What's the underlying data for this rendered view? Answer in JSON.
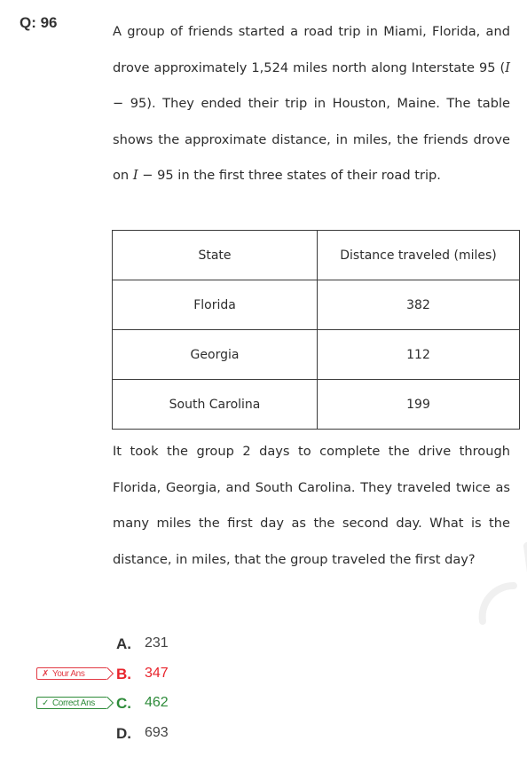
{
  "question": {
    "number_label": "Q: 96",
    "stem_before_table": [
      {
        "text": "A group of friends started a road trip in Miami, Florida, and drove approximately 1,524 miles north along Interstate 95 ("
      },
      {
        "math": "I"
      },
      {
        "text": " − 95). They ended their trip in Houston, Maine. The table shows the approximate distance, in miles, the friends drove on "
      },
      {
        "math": "I"
      },
      {
        "text": " − 95 in the first three states of their road trip."
      }
    ],
    "table": {
      "headers": [
        "State",
        "Distance traveled (miles)"
      ],
      "rows": [
        [
          "Florida",
          "382"
        ],
        [
          "Georgia",
          "112"
        ],
        [
          "South Carolina",
          "199"
        ]
      ]
    },
    "stem_after_table": "It took the group 2 days to complete the drive through Florida, Georgia, and South Carolina. They traveled twice as many miles the first day as the second day. What is the distance, in miles, that the group traveled the first day?",
    "choices": [
      {
        "letter": "A.",
        "value": "231",
        "status": "none",
        "badge": null
      },
      {
        "letter": "B.",
        "value": "347",
        "status": "wrong",
        "badge": {
          "mark": "✗",
          "label": "Your Ans"
        }
      },
      {
        "letter": "C.",
        "value": "462",
        "status": "right",
        "badge": {
          "mark": "✓",
          "label": "Correct Ans"
        }
      },
      {
        "letter": "D.",
        "value": "693",
        "status": "none",
        "badge": null
      }
    ]
  },
  "colors": {
    "wrong": "#e8242c",
    "correct": "#2e8b3a",
    "text": "#2d2d2d"
  },
  "icons": {
    "wrong_mark": "x-mark-icon",
    "correct_mark": "check-mark-icon"
  }
}
